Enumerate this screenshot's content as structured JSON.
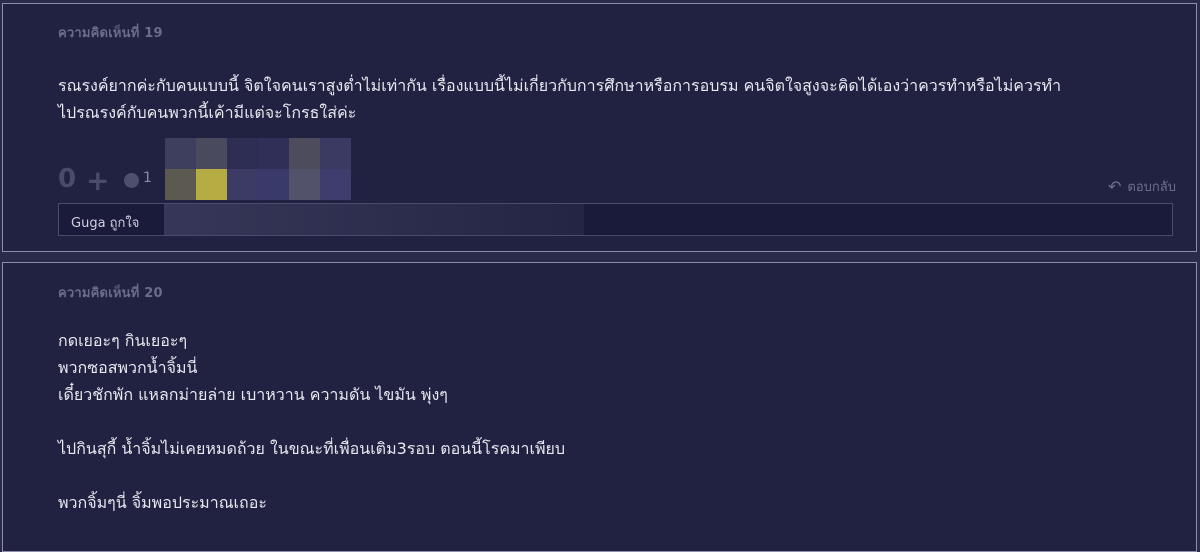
{
  "comment19": {
    "label": "ความคิดเห็นที่ 19",
    "lines": [
      "รณรงค์ยากค่ะกับคนแบบนี้ จิตใจคนเราสูงต่ำไม่เท่ากัน เรื่องแบบนี้ไม่เกี่ยวกับการศึกษาหรือการอบรม คนจิตใจสูงจะคิดได้เองว่าควรทำหรือไม่ควรทำ",
      "ไปรณรงค์กับคนพวกนี้เค้ามีแต่จะโกรธใส่ค่ะ"
    ],
    "vote_count": "0",
    "plus_icon": "plus-icon",
    "emotion_icon": "emotion-icon",
    "emotion_count": "1",
    "reply_label": "ตอบกลับ",
    "reply_icon": "reply-arrow-icon",
    "likers_text": "Guga ถูกใจ"
  },
  "comment20": {
    "label": "ความคิดเห็นที่ 20",
    "lines": [
      "กดเยอะๆ กินเยอะๆ",
      "พวกซอสพวกน้ำจิ้มนี่",
      "เดี๋ยวชักพัก แหลกม่ายล่าย เบาหวาน ความดัน ไขมัน พุ่งๆ",
      "",
      "ไปกินสุกี้ น้ำจิ้มไม่เคยหมดถ้วย ในขณะที่เพื่อนเติม3รอบ ตอนนี้โรคมาเพียบ",
      "",
      "พวกจิ้มๆนี่ จิ้มพอประมาณเถอะ"
    ]
  },
  "colors": {
    "background": "#212142",
    "border": "#8e8eab",
    "text": "#e8e8f0",
    "muted": "#6b6b8a"
  }
}
